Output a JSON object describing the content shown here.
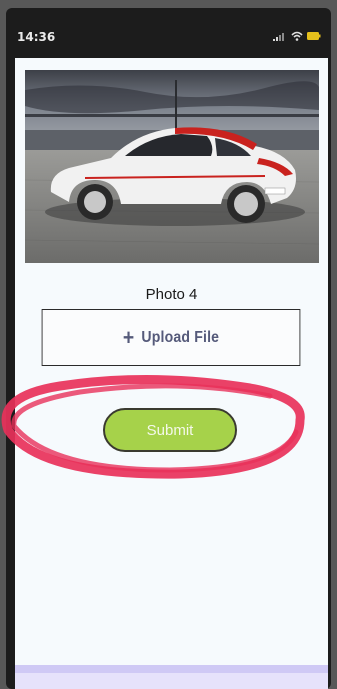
{
  "status_bar": {
    "time": "14:36",
    "icons": [
      "signal-icon",
      "wifi-icon",
      "battery-icon"
    ]
  },
  "form": {
    "photo_label": "Photo 4",
    "upload_label": "Upload File",
    "upload_icon": "plus-icon",
    "submit_label": "Submit"
  },
  "colors": {
    "submit_bg": "#a6d24a",
    "annotation": "#e8315a",
    "screen_bg": "#f6fafd",
    "bottom_bar": "#cfc9f5"
  }
}
